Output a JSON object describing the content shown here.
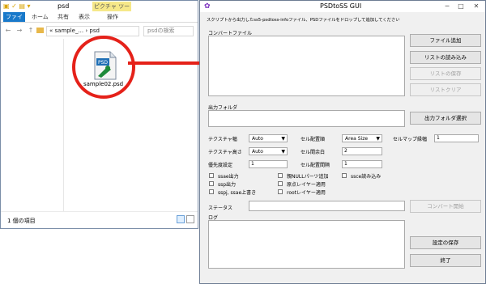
{
  "explorer": {
    "title": "psd",
    "ribbon_tabs": [
      "ファイル",
      "ホーム",
      "共有",
      "表示",
      "操作"
    ],
    "picture_tools": "ピクチャ ツール",
    "address_path": "« sample_... › psd",
    "search_placeholder": "psdの検索",
    "file_name": "sample02.psd",
    "status_text": "1 個の項目"
  },
  "app": {
    "title": "PSDtoSS GUI",
    "instruction": "スクリプトから出力したss5-psdtoss-infoファイル、PSDファイルをドロップして追加してください",
    "convert_file_label": "コンバートファイル",
    "buttons": {
      "add_file": "ファイル追加",
      "load_list": "リストの読み込み",
      "save_list": "リストの保存",
      "clear_list": "リストクリア",
      "select_output": "出力フォルダ選択",
      "start_convert": "コンバート開始",
      "save_settings": "設定の保存",
      "exit": "終了"
    },
    "output_folder_label": "出力フォルダ",
    "settings": {
      "texture_width_label": "テクスチャ幅",
      "texture_width_value": "Auto",
      "texture_height_label": "テクスチャ高さ",
      "texture_height_value": "Auto",
      "priority_label": "優先度設定",
      "priority_value": "1",
      "cell_order_label": "セル配置順",
      "cell_order_value": "Area Size",
      "cell_margin_label": "セル間余白",
      "cell_margin_value": "2",
      "cell_spacing_label": "セル配置間隔",
      "cell_spacing_value": "1",
      "cellmap_width_label": "セルマップ縁幅",
      "cellmap_width_value": "1"
    },
    "checkboxes": {
      "ssae_output": "ssae出力",
      "ssp_output": "ssp出力",
      "overwrite": "sspj, ssae上書き",
      "null_parts": "親NULLパーツ追加",
      "origin_layer": "原点レイヤー適用",
      "root_layer": "rootレイヤー適用",
      "ssce_load": "ssce読み込み"
    },
    "status_label": "ステータス",
    "log_label": "ログ"
  },
  "colors": {
    "accent_red": "#e52119",
    "file_tab_blue": "#1979ca",
    "picture_tools_yellow": "#f6e889",
    "title_icon_purple": "#7b2fbe"
  }
}
